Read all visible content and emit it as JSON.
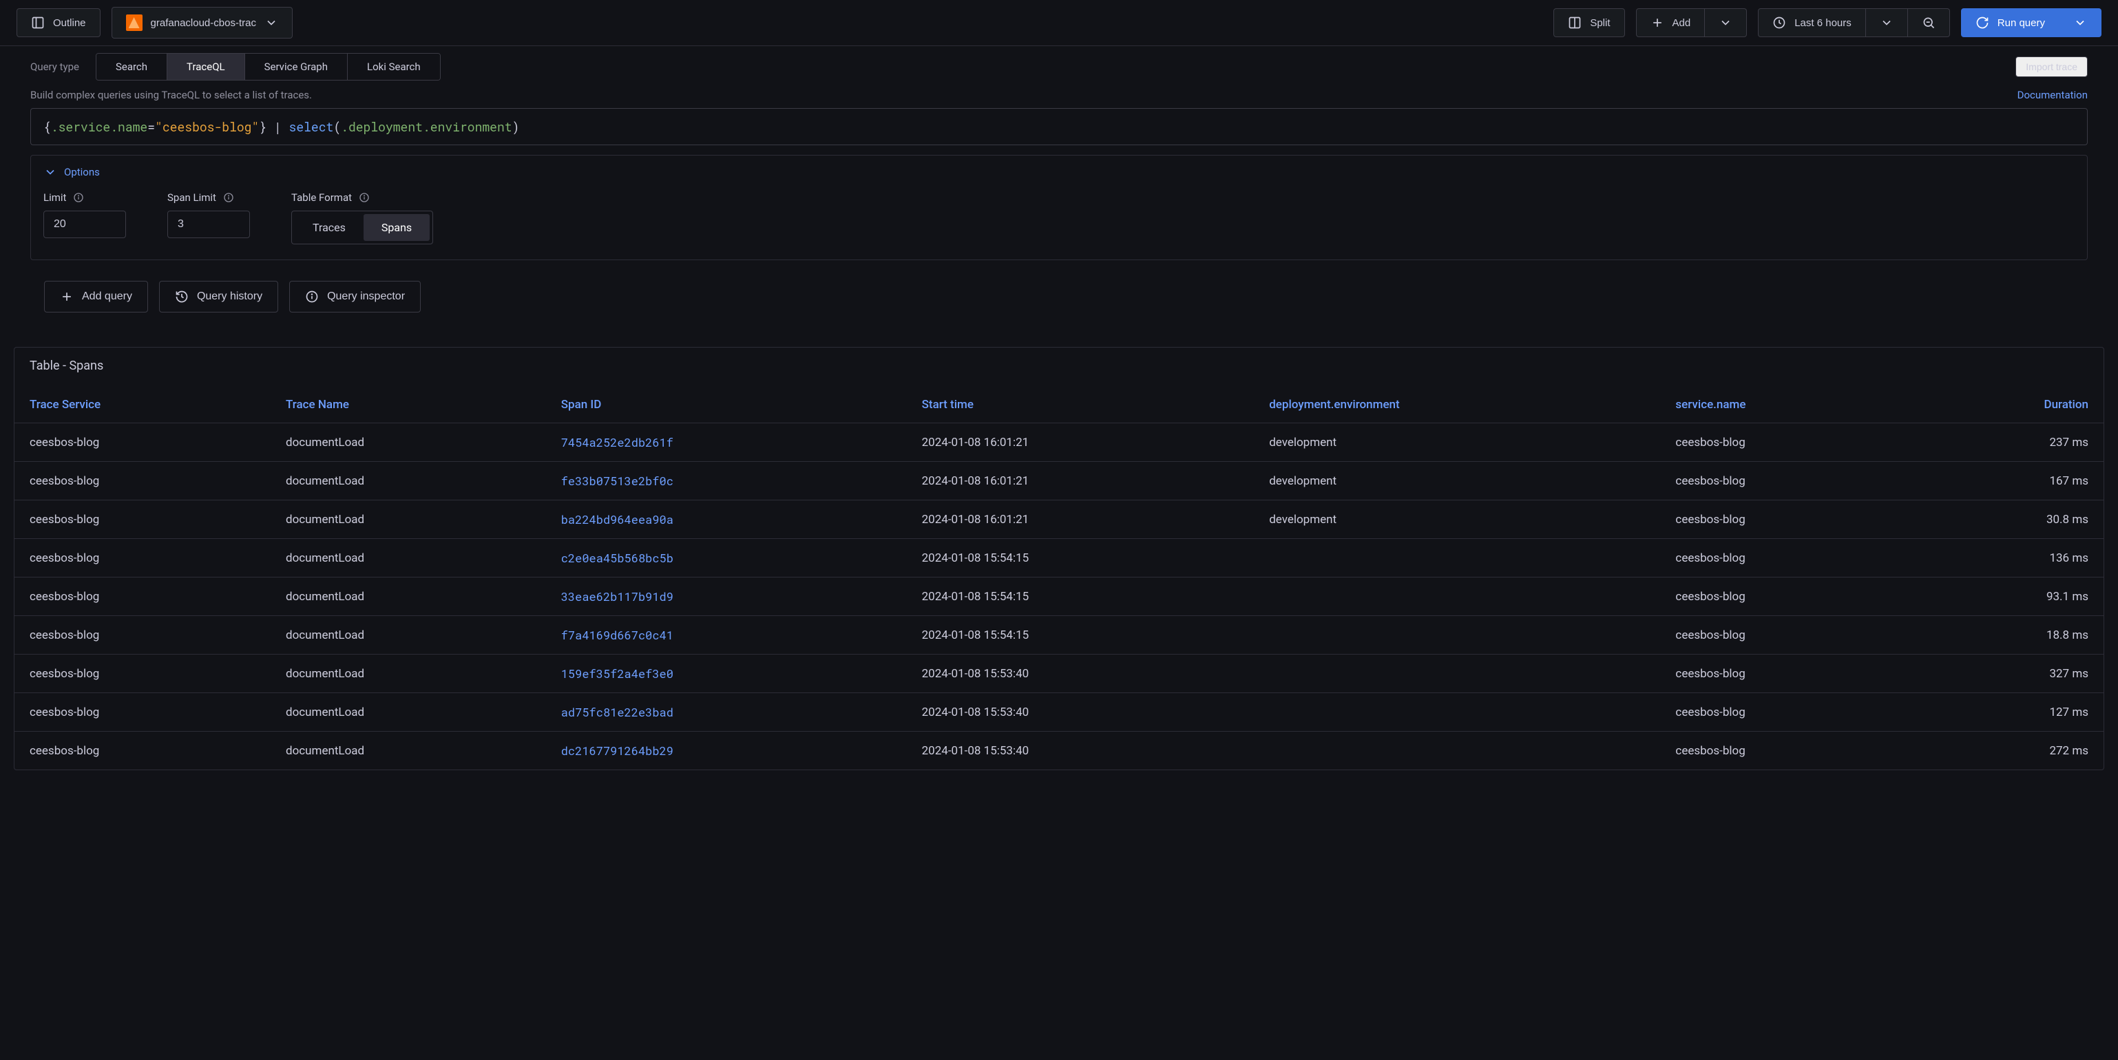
{
  "topbar": {
    "outline": "Outline",
    "datasource": "grafanacloud-cbos-trac",
    "split": "Split",
    "add": "Add",
    "timerange": "Last 6 hours",
    "run": "Run query"
  },
  "query": {
    "type_label": "Query type",
    "tabs": [
      "Search",
      "TraceQL",
      "Service Graph",
      "Loki Search"
    ],
    "active_tab": "TraceQL",
    "import": "Import trace",
    "help": "Build complex queries using TraceQL to select a list of traces.",
    "doc": "Documentation",
    "code": {
      "brace_open": "{",
      "attr1": ".service.name",
      "eq": "=",
      "str": "\"ceesbos-blog\"",
      "brace_close": "}",
      "pipe": " | ",
      "fn": "select",
      "paren_open": "(",
      "attr2": ".deployment.environment",
      "paren_close": ")"
    }
  },
  "options": {
    "header": "Options",
    "limit_label": "Limit",
    "limit_value": "20",
    "span_limit_label": "Span Limit",
    "span_limit_value": "3",
    "table_format_label": "Table Format",
    "format_options": [
      "Traces",
      "Spans"
    ],
    "format_active": "Spans"
  },
  "actions": {
    "add_query": "Add query",
    "query_history": "Query history",
    "query_inspector": "Query inspector"
  },
  "results": {
    "title": "Table - Spans",
    "columns": [
      "Trace Service",
      "Trace Name",
      "Span ID",
      "Start time",
      "deployment.environment",
      "service.name",
      "Duration"
    ],
    "rows": [
      {
        "service": "ceesbos-blog",
        "name": "documentLoad",
        "span": "7454a252e2db261f",
        "time": "2024-01-08 16:01:21",
        "env": "development",
        "sname": "ceesbos-blog",
        "dur": "237 ms"
      },
      {
        "service": "ceesbos-blog",
        "name": "documentLoad",
        "span": "fe33b07513e2bf0c",
        "time": "2024-01-08 16:01:21",
        "env": "development",
        "sname": "ceesbos-blog",
        "dur": "167 ms"
      },
      {
        "service": "ceesbos-blog",
        "name": "documentLoad",
        "span": "ba224bd964eea90a",
        "time": "2024-01-08 16:01:21",
        "env": "development",
        "sname": "ceesbos-blog",
        "dur": "30.8 ms"
      },
      {
        "service": "ceesbos-blog",
        "name": "documentLoad",
        "span": "c2e0ea45b568bc5b",
        "time": "2024-01-08 15:54:15",
        "env": "",
        "sname": "ceesbos-blog",
        "dur": "136 ms"
      },
      {
        "service": "ceesbos-blog",
        "name": "documentLoad",
        "span": "33eae62b117b91d9",
        "time": "2024-01-08 15:54:15",
        "env": "",
        "sname": "ceesbos-blog",
        "dur": "93.1 ms"
      },
      {
        "service": "ceesbos-blog",
        "name": "documentLoad",
        "span": "f7a4169d667c0c41",
        "time": "2024-01-08 15:54:15",
        "env": "",
        "sname": "ceesbos-blog",
        "dur": "18.8 ms"
      },
      {
        "service": "ceesbos-blog",
        "name": "documentLoad",
        "span": "159ef35f2a4ef3e0",
        "time": "2024-01-08 15:53:40",
        "env": "",
        "sname": "ceesbos-blog",
        "dur": "327 ms"
      },
      {
        "service": "ceesbos-blog",
        "name": "documentLoad",
        "span": "ad75fc81e22e3bad",
        "time": "2024-01-08 15:53:40",
        "env": "",
        "sname": "ceesbos-blog",
        "dur": "127 ms"
      },
      {
        "service": "ceesbos-blog",
        "name": "documentLoad",
        "span": "dc2167791264bb29",
        "time": "2024-01-08 15:53:40",
        "env": "",
        "sname": "ceesbos-blog",
        "dur": "272 ms"
      }
    ]
  }
}
